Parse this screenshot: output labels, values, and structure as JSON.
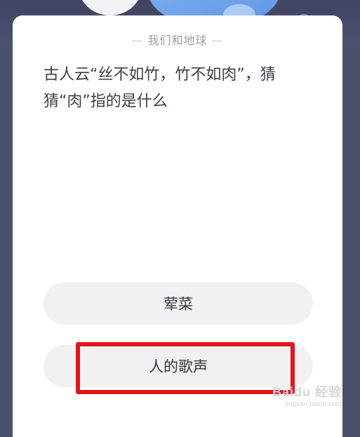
{
  "quiz": {
    "category": "我们和地球",
    "question": "古人云“丝不如竹，竹不如肉”，猜猜“肉”指的是什么",
    "options": [
      {
        "label": "荤菜"
      },
      {
        "label": "人的歌声"
      }
    ]
  },
  "annotation": {
    "highlighted_option": "人的歌声",
    "color": "#e0151c"
  },
  "watermark": {
    "brand": "Baidu 经验",
    "url": "jingyan.baidu.com"
  },
  "colors": {
    "background_top": "#4a4f6a",
    "card": "#ffffff",
    "option_bg": "#f1f1f4",
    "accent_blue": "#5e95e6"
  }
}
